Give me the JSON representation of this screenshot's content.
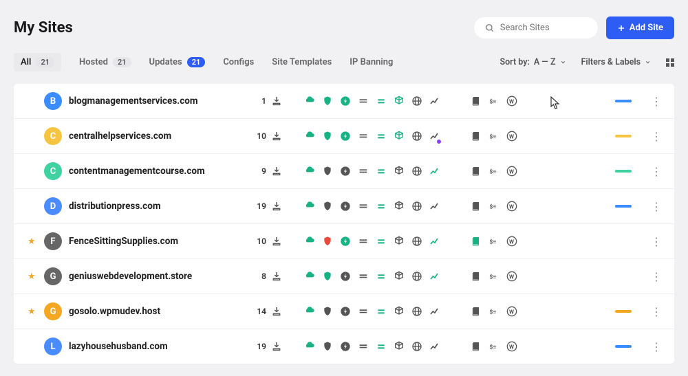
{
  "header": {
    "title": "My Sites",
    "search_placeholder": "Search Sites",
    "add_label": "Add Site"
  },
  "tabs": {
    "all": {
      "label": "All",
      "count": "21"
    },
    "hosted": {
      "label": "Hosted",
      "count": "21"
    },
    "updates": {
      "label": "Updates",
      "count": "21"
    },
    "configs": {
      "label": "Configs"
    },
    "templates": {
      "label": "Site Templates"
    },
    "ip": {
      "label": "IP Banning"
    }
  },
  "controls": {
    "sort_label": "Sort by:",
    "sort_value": "A — Z",
    "filters_label": "Filters & Labels"
  },
  "colors": {
    "blue": "#3a8cff",
    "orange": "#f5a623",
    "teal": "#3fd1a0",
    "darkblue": "#4a6cf7",
    "gray": "#666"
  },
  "sites": [
    {
      "letter": "B",
      "avatar": "#3a8cff",
      "name": "blogmanagementservices.com",
      "updates": "1",
      "starred": false,
      "status": "#3a8cff",
      "shield": "green",
      "chart": "gray",
      "doc": "gray"
    },
    {
      "letter": "C",
      "avatar": "#f5c542",
      "name": "centralhelpservices.com",
      "updates": "10",
      "starred": false,
      "status": "#f5c542",
      "shield": "green",
      "chart": "gray",
      "doc": "gray"
    },
    {
      "letter": "C",
      "avatar": "#3fd1a0",
      "name": "contentmanagementcourse.com",
      "updates": "9",
      "starred": false,
      "status": "#3fd1a0",
      "shield": "gray",
      "chart": "green",
      "doc": "gray"
    },
    {
      "letter": "D",
      "avatar": "#4a8cff",
      "name": "distributionpress.com",
      "updates": "19",
      "starred": false,
      "status": "#3a8cff",
      "shield": "gray",
      "chart": "gray",
      "doc": "gray"
    },
    {
      "letter": "F",
      "avatar": "#666",
      "name": "FenceSittingSupplies.com",
      "updates": "10",
      "starred": true,
      "status": "",
      "shield": "red",
      "chart": "green",
      "doc": "green"
    },
    {
      "letter": "G",
      "avatar": "#666",
      "name": "geniuswebdevelopment.store",
      "updates": "8",
      "starred": true,
      "status": "",
      "shield": "green",
      "chart": "green",
      "doc": "gray"
    },
    {
      "letter": "G",
      "avatar": "#f5a623",
      "name": "gosolo.wpmudev.host",
      "updates": "14",
      "starred": true,
      "status": "#f5a623",
      "shield": "gray",
      "chart": "gray",
      "doc": "gray"
    },
    {
      "letter": "L",
      "avatar": "#4a8cff",
      "name": "lazyhousehusband.com",
      "updates": "19",
      "starred": false,
      "status": "#3a8cff",
      "shield": "gray",
      "chart": "gray",
      "doc": "gray"
    }
  ]
}
